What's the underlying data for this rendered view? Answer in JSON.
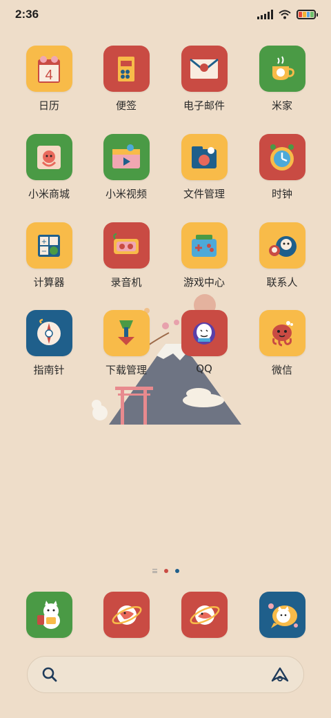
{
  "status_bar": {
    "time": "2:36",
    "battery_colors": [
      "#e5483a",
      "#f2b233",
      "#5aa6df",
      "#6dc06d"
    ]
  },
  "colors": {
    "background": "#eeddc9",
    "red": "#c94b43",
    "yellow": "#f8bb49",
    "green": "#4a9a45",
    "blue": "#1f5f8b",
    "page_dot_active": "#1f5f8b",
    "page_dot_red": "#c94b43"
  },
  "apps": [
    {
      "label": "日历",
      "icon": "calendar-icon",
      "bg": "#f8bb49",
      "glyph": "4"
    },
    {
      "label": "便签",
      "icon": "notes-icon",
      "bg": "#c94b43"
    },
    {
      "label": "电子邮件",
      "icon": "mail-icon",
      "bg": "#c94b43"
    },
    {
      "label": "米家",
      "icon": "mijia-teacup-icon",
      "bg": "#4a9a45"
    },
    {
      "label": "小米商城",
      "icon": "mi-store-octopus-icon",
      "bg": "#4a9a45"
    },
    {
      "label": "小米视频",
      "icon": "mi-video-icon",
      "bg": "#4a9a45"
    },
    {
      "label": "文件管理",
      "icon": "file-manager-icon",
      "bg": "#f8bb49"
    },
    {
      "label": "时钟",
      "icon": "clock-icon",
      "bg": "#c94b43"
    },
    {
      "label": "计算器",
      "icon": "calculator-icon",
      "bg": "#f8bb49"
    },
    {
      "label": "录音机",
      "icon": "recorder-icon",
      "bg": "#c94b43"
    },
    {
      "label": "游戏中心",
      "icon": "game-center-icon",
      "bg": "#f8bb49"
    },
    {
      "label": "联系人",
      "icon": "contacts-daruma-icon",
      "bg": "#f8bb49"
    },
    {
      "label": "指南针",
      "icon": "compass-icon",
      "bg": "#1f5f8b"
    },
    {
      "label": "下载管理",
      "icon": "download-icon",
      "bg": "#f8bb49"
    },
    {
      "label": "QQ",
      "icon": "qq-icon",
      "bg": "#c94b43"
    },
    {
      "label": "微信",
      "icon": "wechat-octopus-icon",
      "bg": "#f8bb49"
    }
  ],
  "dock": [
    {
      "icon": "lucky-cat-icon",
      "bg": "#4a9a45"
    },
    {
      "icon": "browser-planet-icon",
      "bg": "#c94b43"
    },
    {
      "icon": "gallery-planet-icon",
      "bg": "#c94b43"
    },
    {
      "icon": "cat-bubble-icon",
      "bg": "#1f5f8b"
    }
  ],
  "search": {
    "left_icon": "search-icon",
    "right_icon": "assistant-icon"
  }
}
